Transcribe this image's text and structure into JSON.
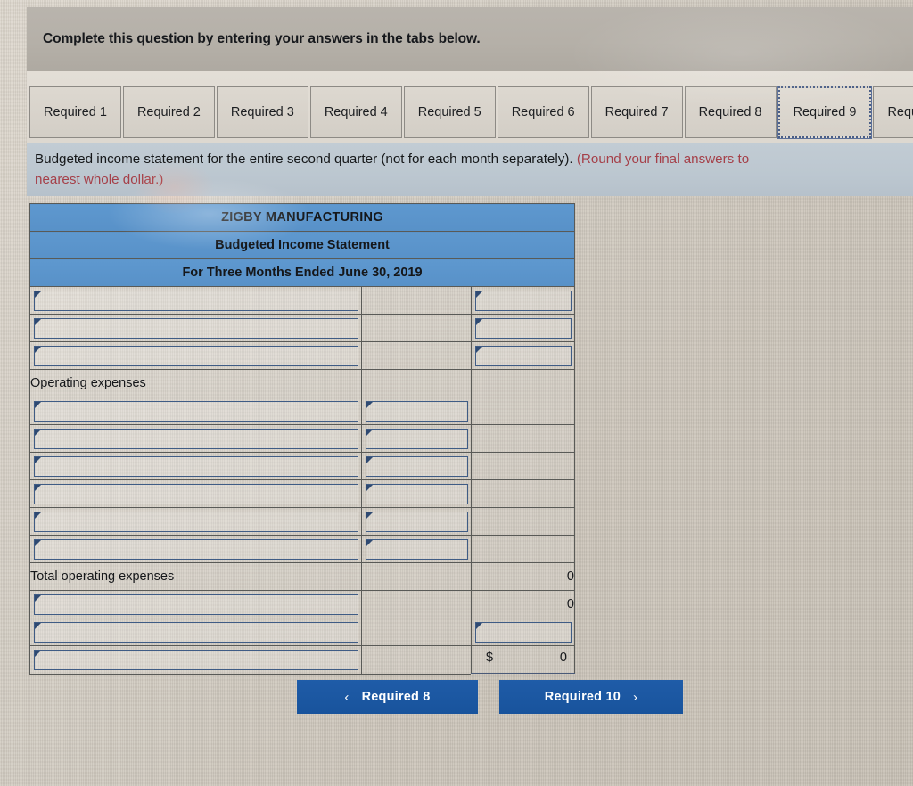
{
  "header": {
    "instruction": "Complete this question by entering your answers in the tabs below."
  },
  "tabs": {
    "items": [
      {
        "label": "Required 1",
        "active": false
      },
      {
        "label": "Required 2",
        "active": false
      },
      {
        "label": "Required 3",
        "active": false
      },
      {
        "label": "Required 4",
        "active": false
      },
      {
        "label": "Required 5",
        "active": false
      },
      {
        "label": "Required 6",
        "active": false
      },
      {
        "label": "Required 7",
        "active": false
      },
      {
        "label": "Required 8",
        "active": false
      },
      {
        "label": "Required 9",
        "active": true
      },
      {
        "label": "Required",
        "active": false
      }
    ]
  },
  "question": {
    "text_black": "Budgeted income statement for the entire second quarter (not for each month separately). ",
    "text_red_inline": "(Round your final answers to",
    "text_red_line2": "nearest whole dollar.)"
  },
  "statement": {
    "title_line1": "ZIGBY MANUFACTURING",
    "title_line2": "Budgeted Income Statement",
    "title_line3": "For Three Months Ended June 30, 2019",
    "rows": [
      {
        "c1_type": "input",
        "c1_value": "",
        "c2_type": "empty",
        "c2_value": "",
        "c3_type": "input",
        "c3_value": ""
      },
      {
        "c1_type": "input",
        "c1_value": "",
        "c2_type": "empty",
        "c2_value": "",
        "c3_type": "input",
        "c3_value": ""
      },
      {
        "c1_type": "input",
        "c1_value": "",
        "c2_type": "empty",
        "c2_value": "",
        "c3_type": "input",
        "c3_value": ""
      },
      {
        "c1_type": "label",
        "c1_value": "Operating expenses",
        "c2_type": "empty",
        "c2_value": "",
        "c3_type": "empty",
        "c3_value": ""
      },
      {
        "c1_type": "input",
        "c1_value": "",
        "c2_type": "input",
        "c2_value": "",
        "c3_type": "empty",
        "c3_value": ""
      },
      {
        "c1_type": "input",
        "c1_value": "",
        "c2_type": "input",
        "c2_value": "",
        "c3_type": "empty",
        "c3_value": ""
      },
      {
        "c1_type": "input",
        "c1_value": "",
        "c2_type": "input",
        "c2_value": "",
        "c3_type": "empty",
        "c3_value": ""
      },
      {
        "c1_type": "input",
        "c1_value": "",
        "c2_type": "input",
        "c2_value": "",
        "c3_type": "empty",
        "c3_value": ""
      },
      {
        "c1_type": "input",
        "c1_value": "",
        "c2_type": "input",
        "c2_value": "",
        "c3_type": "empty",
        "c3_value": ""
      },
      {
        "c1_type": "input",
        "c1_value": "",
        "c2_type": "input",
        "c2_value": "",
        "c3_type": "empty",
        "c3_value": ""
      },
      {
        "c1_type": "label",
        "c1_value": "Total operating expenses",
        "c2_type": "empty",
        "c2_value": "",
        "c3_type": "value",
        "c3_value": "0"
      },
      {
        "c1_type": "input",
        "c1_value": "",
        "c2_type": "empty",
        "c2_value": "",
        "c3_type": "value",
        "c3_value": "0"
      },
      {
        "c1_type": "input",
        "c1_value": "",
        "c2_type": "empty",
        "c2_value": "",
        "c3_type": "input",
        "c3_value": ""
      },
      {
        "c1_type": "input",
        "c1_value": "",
        "c2_type": "empty",
        "c2_value": "",
        "c3_type": "total",
        "c3_currency": "$",
        "c3_value": "0"
      }
    ]
  },
  "nav": {
    "prev_label": "Required 8",
    "next_label": "Required 10",
    "prev_chevron": "‹",
    "next_chevron": "›"
  },
  "colors": {
    "header_blue": "#5891c8",
    "button_blue": "#1f5ca8",
    "red_text": "#a54049",
    "input_border": "#3f5c85"
  }
}
